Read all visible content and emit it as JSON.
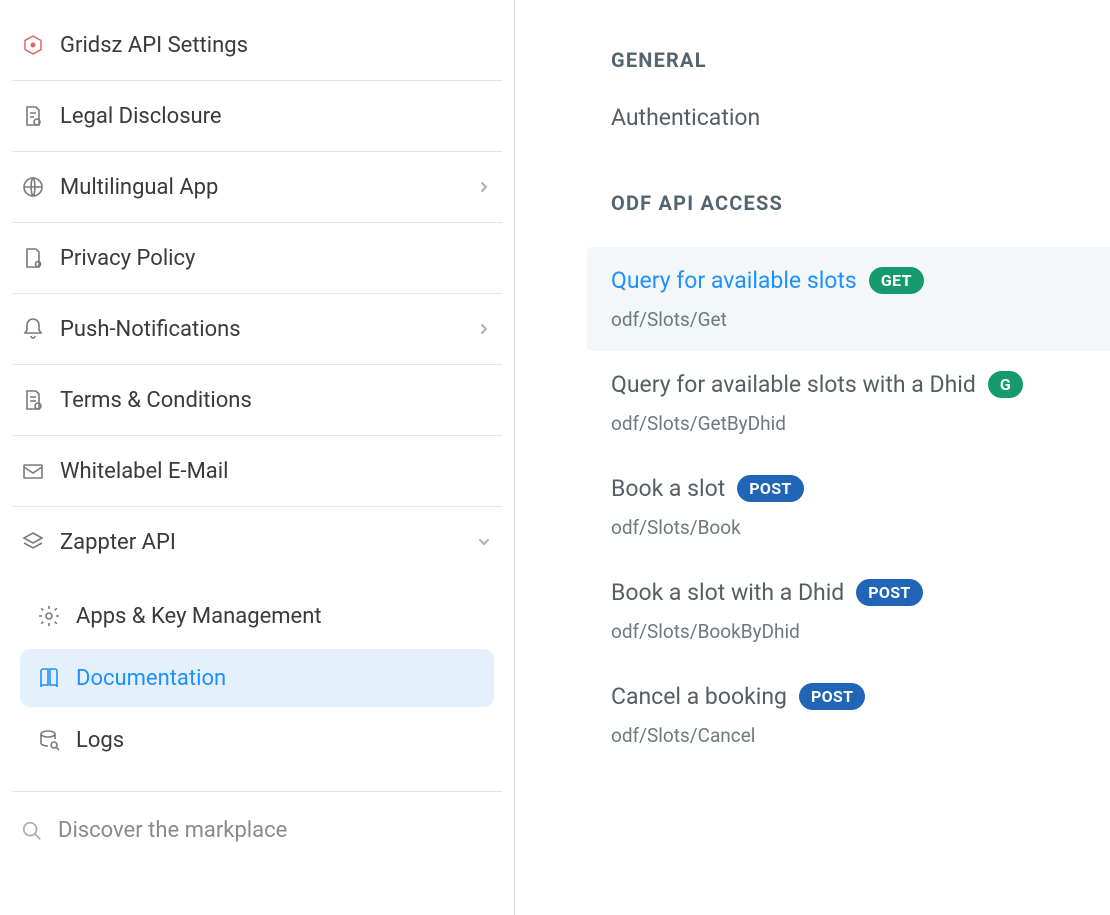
{
  "sidebar": {
    "items": [
      {
        "label": "Gridsz API Settings",
        "icon": "grid-icon",
        "expandable": false
      },
      {
        "label": "Legal Disclosure",
        "icon": "document-info-icon",
        "expandable": false
      },
      {
        "label": "Multilingual App",
        "icon": "globe-icon",
        "expandable": true
      },
      {
        "label": "Privacy Policy",
        "icon": "shield-document-icon",
        "expandable": false
      },
      {
        "label": "Push-Notifications",
        "icon": "bell-icon",
        "expandable": true
      },
      {
        "label": "Terms & Conditions",
        "icon": "document-check-icon",
        "expandable": false
      },
      {
        "label": "Whitelabel E-Mail",
        "icon": "envelope-icon",
        "expandable": false
      },
      {
        "label": "Zappter API",
        "icon": "stack-icon",
        "expandable": true,
        "expanded": true
      }
    ],
    "sub_items": [
      {
        "label": "Apps & Key Management",
        "icon": "gear-icon"
      },
      {
        "label": "Documentation",
        "icon": "book-icon",
        "active": true
      },
      {
        "label": "Logs",
        "icon": "database-search-icon"
      }
    ],
    "discover_label": "Discover the markplace"
  },
  "content": {
    "sections": [
      {
        "heading": "GENERAL",
        "items": [
          {
            "label": "Authentication"
          }
        ]
      },
      {
        "heading": "ODF API ACCESS",
        "api_items": [
          {
            "title": "Query for available slots",
            "method": "GET",
            "path": "odf/Slots/Get",
            "active": true
          },
          {
            "title": "Query for available slots with a Dhid",
            "method": "GET",
            "path": "odf/Slots/GetByDhid",
            "active": false,
            "truncated_badge": "G"
          },
          {
            "title": "Book a slot",
            "method": "POST",
            "path": "odf/Slots/Book",
            "active": false
          },
          {
            "title": "Book a slot with a Dhid",
            "method": "POST",
            "path": "odf/Slots/BookByDhid",
            "active": false
          },
          {
            "title": "Cancel a booking",
            "method": "POST",
            "path": "odf/Slots/Cancel",
            "active": false
          }
        ]
      }
    ]
  }
}
